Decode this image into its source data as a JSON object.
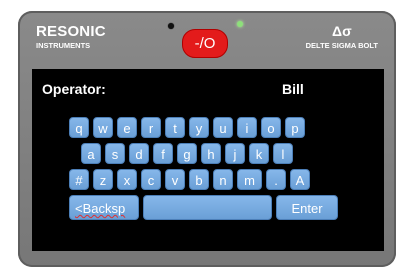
{
  "brand": {
    "name": "RESONIC",
    "subtitle": "INSTRUMENTS"
  },
  "model": {
    "symbol": "Δσ",
    "name": "DELTE SIGMA BOLT"
  },
  "power_button": {
    "label": "-/O",
    "color": "#e31b1b"
  },
  "indicators": {
    "left_led_color": "#111111",
    "right_led_color": "#8de07a"
  },
  "operator": {
    "label": "Operator:",
    "value": "Bill"
  },
  "keyboard": {
    "key_color": "#79ace2",
    "row1": [
      "q",
      "w",
      "e",
      "r",
      "t",
      "y",
      "u",
      "i",
      "o",
      "p"
    ],
    "row2": [
      "a",
      "s",
      "d",
      "f",
      "g",
      "h",
      "j",
      "k",
      "l"
    ],
    "row3": [
      "#",
      "z",
      "x",
      "c",
      "v",
      "b",
      "n",
      "m",
      ".",
      "A"
    ],
    "backspace_label": "<Backsp",
    "space_label": "",
    "enter_label": "Enter"
  }
}
